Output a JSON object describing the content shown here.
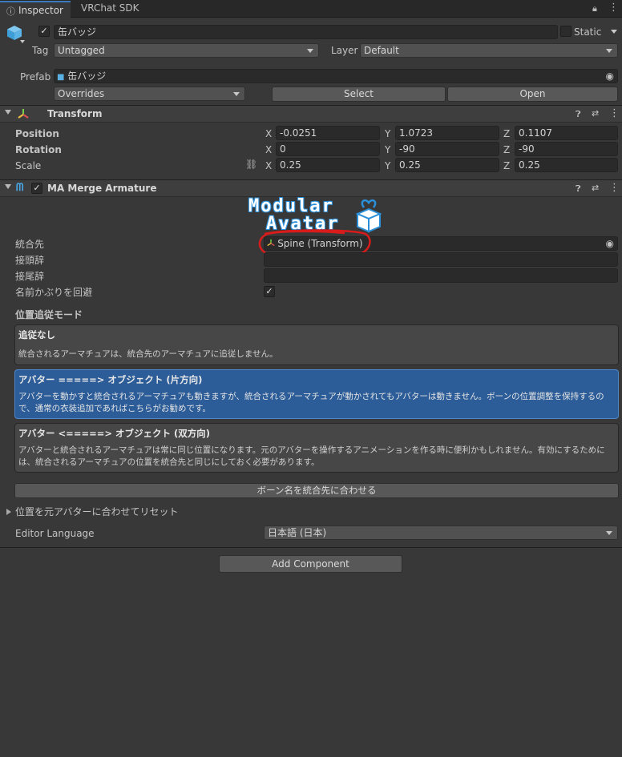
{
  "tabs": {
    "inspector": "Inspector",
    "vrchat_sdk": "VRChat SDK"
  },
  "object": {
    "name": "缶バッジ",
    "static_label": "Static",
    "tag_label": "Tag",
    "tag_value": "Untagged",
    "layer_label": "Layer",
    "layer_value": "Default",
    "prefab_label": "Prefab",
    "prefab_value": "缶バッジ",
    "overrides": "Overrides",
    "select": "Select",
    "open": "Open"
  },
  "transform": {
    "title": "Transform",
    "position_label": "Position",
    "rotation_label": "Rotation",
    "scale_label": "Scale",
    "axes": [
      "X",
      "Y",
      "Z"
    ],
    "position": [
      "-0.0251",
      "1.0723",
      "0.1107"
    ],
    "rotation": [
      "0",
      "-90",
      "-90"
    ],
    "scale": [
      "0.25",
      "0.25",
      "0.25"
    ]
  },
  "merge": {
    "title": "MA Merge Armature",
    "logo_line1": "Modular",
    "logo_line2": "Avatar",
    "target_label": "統合先",
    "target_value": "Spine (Transform)",
    "prefix_label": "接頭辞",
    "suffix_label": "接尾辞",
    "avoid_label": "名前かぶりを回避",
    "mode_heading": "位置追従モード",
    "modes": [
      {
        "title": "追従なし",
        "desc": "統合されるアーマチュアは、統合先のアーマチュアに追従しません。"
      },
      {
        "title": "アバター =====> オブジェクト (片方向)",
        "desc": "アバターを動かすと統合されるアーマチュアも動きますが、統合されるアーマチュアが動かされてもアバターは動きません。ボーンの位置調整を保持するので、通常の衣装追加であればこちらがお勧めです。"
      },
      {
        "title": "アバター <=====> オブジェクト (双方向)",
        "desc": "アバターと統合されるアーマチュアは常に同じ位置になります。元のアバターを操作するアニメーションを作る時に便利かもしれません。有効にするためには、統合されるアーマチュアの位置を統合先と同じにしておく必要があります。"
      }
    ],
    "rename_button": "ボーン名を統合先に合わせる",
    "reset_foldout": "位置を元アバターに合わせてリセット",
    "language_label": "Editor Language",
    "language_value": "日本語 (日本)"
  },
  "add_component": "Add Component",
  "colors": {
    "selected_mode": "#2c5d99",
    "annotation": "#d81b1b",
    "background": "#383838"
  }
}
